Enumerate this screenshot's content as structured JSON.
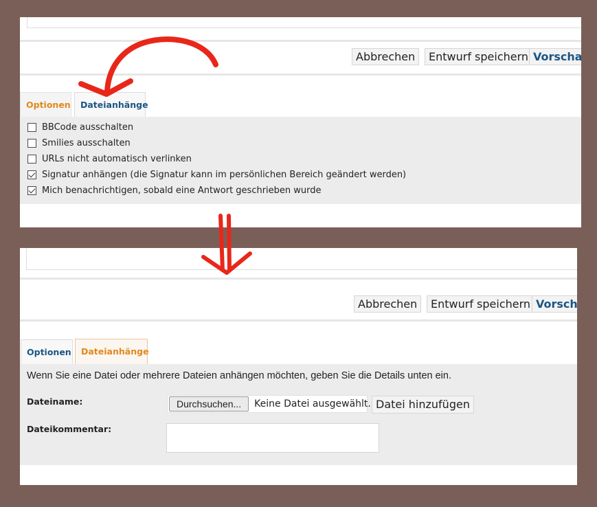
{
  "top": {
    "toolbar": {
      "cancel_label": "Abbrechen",
      "draft_label": "Entwurf speichern",
      "preview_label": "Vorschau"
    },
    "tabs": [
      {
        "label": "Optionen",
        "state": "active"
      },
      {
        "label": "Dateianhänge",
        "state": "inactive"
      }
    ],
    "options": [
      {
        "label": "BBCode ausschalten",
        "checked": false
      },
      {
        "label": "Smilies ausschalten",
        "checked": false
      },
      {
        "label": "URLs nicht automatisch verlinken",
        "checked": false
      },
      {
        "label": "Signatur anhängen (die Signatur kann im persönlichen Bereich geändert werden)",
        "checked": true
      },
      {
        "label": "Mich benachrichtigen, sobald eine Antwort geschrieben wurde",
        "checked": true
      }
    ]
  },
  "bottom": {
    "toolbar": {
      "cancel_label": "Abbrechen",
      "draft_label": "Entwurf speichern",
      "preview_label": "Vorschau"
    },
    "tabs": [
      {
        "label": "Optionen",
        "state": "inactive"
      },
      {
        "label": "Dateianhänge",
        "state": "active"
      }
    ],
    "attachments": {
      "intro": "Wenn Sie eine Datei oder mehrere Dateien anhängen möchten, geben Sie die Details unten ein.",
      "filename_label": "Dateiname:",
      "browse_label": "Durchsuchen...",
      "no_file_label": "Keine Datei ausgewählt.",
      "add_file_label": "Datei hinzufügen",
      "comment_label": "Dateikommentar:",
      "comment_value": ""
    }
  },
  "colors": {
    "background": "#7a5f58",
    "accent_blue": "#1b5584",
    "accent_orange": "#e0891e",
    "annotation_red": "#e8271a"
  },
  "annotations": [
    "curved-arrow-to-attachments-tab",
    "double-down-arrow"
  ]
}
